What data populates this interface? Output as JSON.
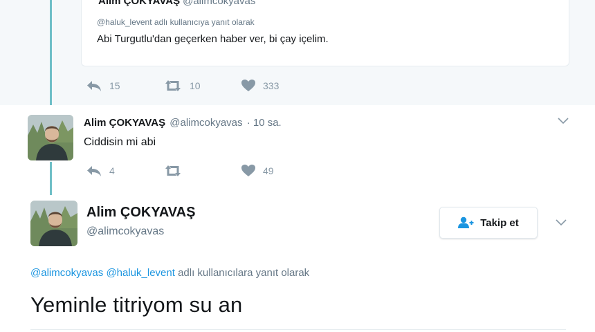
{
  "quoted_tweet": {
    "display_name": "Alim ÇOKYAVAŞ",
    "handle": "@alimcokyavas",
    "reply_context": "@haluk_levent adlı kullanıcıya yanıt olarak",
    "text": "Abi Turgutlu'dan geçerken haber ver, bi çay içelim.",
    "actions": {
      "replies": "15",
      "retweets": "10",
      "likes": "333"
    }
  },
  "reply_tweet": {
    "display_name": "Alim ÇOKYAVAŞ",
    "handle": "@alimcokyavas",
    "time": "· 10 sa.",
    "text": "Ciddisin mi abi",
    "actions": {
      "replies": "4",
      "retweets": "",
      "likes": "49"
    },
    "avatar_icon": "user-photo"
  },
  "main_tweet": {
    "display_name": "Alim ÇOKYAVAŞ",
    "handle": "@alimcokyavas",
    "follow_label": "Takip et",
    "reply_mentions": [
      "@alimcokyavas",
      "@haluk_levent"
    ],
    "reply_suffix": "adlı kullanıcılara yanıt olarak",
    "text": "Yeminle titriyom su an",
    "avatar_icon": "user-photo"
  },
  "colors": {
    "accent": "#1b95e0",
    "thread_line": "#6fbfc7",
    "secondary_text": "#657786",
    "icon_gray": "#8899a6"
  }
}
